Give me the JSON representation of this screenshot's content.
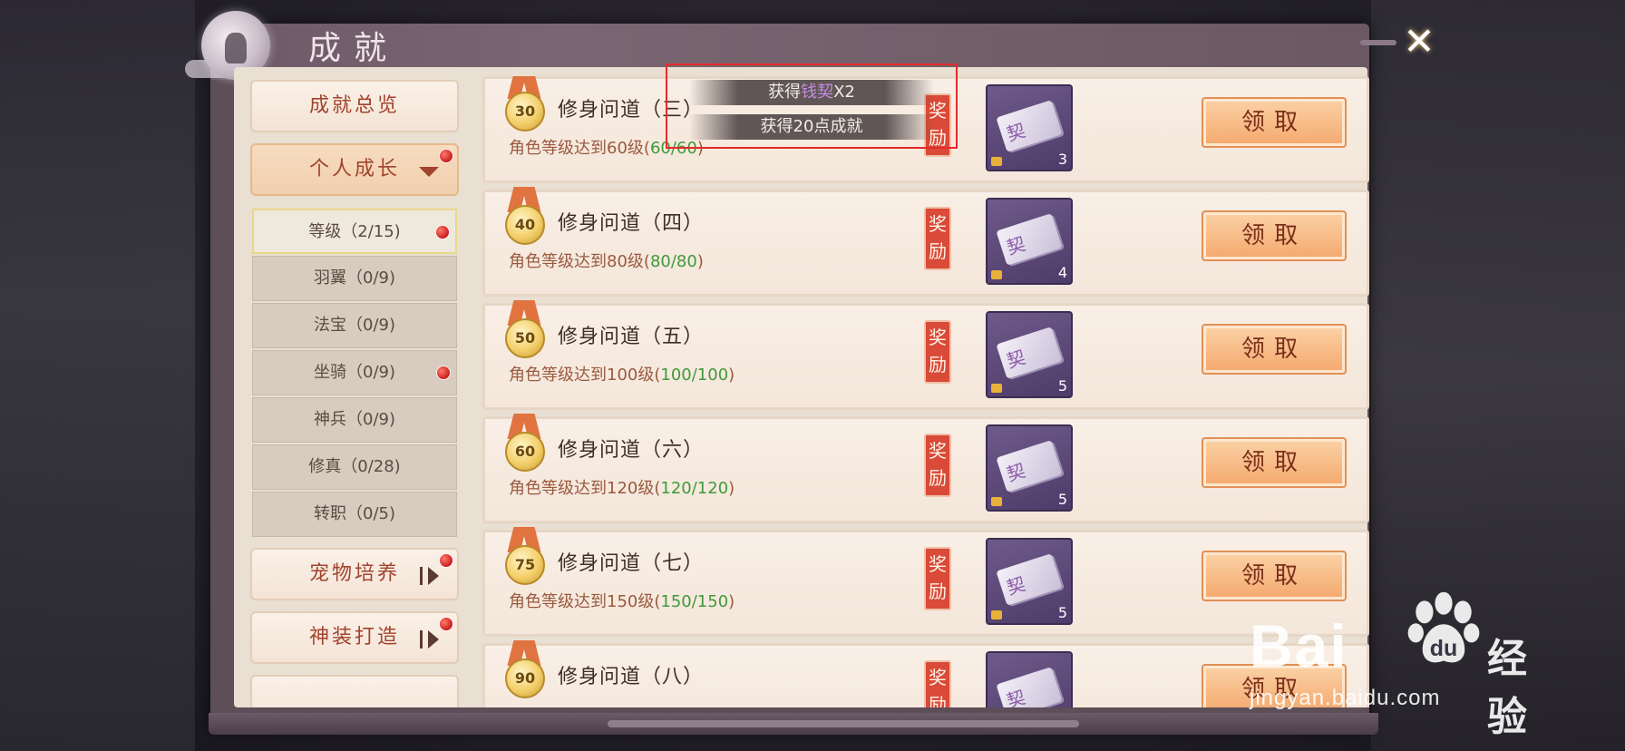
{
  "window": {
    "title": "成就",
    "close_label": "✕"
  },
  "sidebar": {
    "overview": "成就总览",
    "personal": {
      "label": "个人成长",
      "sub_items": [
        "等级（2/15)",
        "羽翼（0/9)",
        "法宝（0/9)",
        "坐骑（0/9)",
        "神兵（0/9)",
        "修真（0/28)",
        "转职（0/5)"
      ]
    },
    "pet": "宠物培养",
    "gear": "神装打造"
  },
  "achievements": [
    {
      "medal": "30",
      "title": "修身问道（三）",
      "desc_prefix": "角色等级达到60级(",
      "progress": "60/60",
      "desc_suffix": ")",
      "reward_tag": "奖励",
      "item_count": "3",
      "button": "领取"
    },
    {
      "medal": "40",
      "title": "修身问道（四）",
      "desc_prefix": "角色等级达到80级(",
      "progress": "80/80",
      "desc_suffix": ")",
      "reward_tag": "奖励",
      "item_count": "4",
      "button": "领取"
    },
    {
      "medal": "50",
      "title": "修身问道（五）",
      "desc_prefix": "角色等级达到100级(",
      "progress": "100/100",
      "desc_suffix": ")",
      "reward_tag": "奖励",
      "item_count": "5",
      "button": "领取"
    },
    {
      "medal": "60",
      "title": "修身问道（六）",
      "desc_prefix": "角色等级达到120级(",
      "progress": "120/120",
      "desc_suffix": ")",
      "reward_tag": "奖励",
      "item_count": "5",
      "button": "领取"
    },
    {
      "medal": "75",
      "title": "修身问道（七）",
      "desc_prefix": "角色等级达到150级(",
      "progress": "150/150",
      "desc_suffix": ")",
      "reward_tag": "奖励",
      "item_count": "5",
      "button": "领取"
    },
    {
      "medal": "90",
      "title": "修身问道（八）",
      "desc_prefix": "",
      "progress": "",
      "desc_suffix": "",
      "reward_tag": "奖励",
      "item_count": "",
      "button": "领取"
    }
  ],
  "toast": {
    "line1_prefix": "获得",
    "line1_item": "钱契",
    "line1_suffix": "X2",
    "line2": "获得20点成就"
  },
  "watermark": {
    "brand": "Bai",
    "brand_cn": "经验",
    "url": "jingyan.baidu.com"
  },
  "colors": {
    "accent_red": "#d94a38",
    "progress_green": "#3f9a3a",
    "highlight_box": "#e52b2b"
  }
}
